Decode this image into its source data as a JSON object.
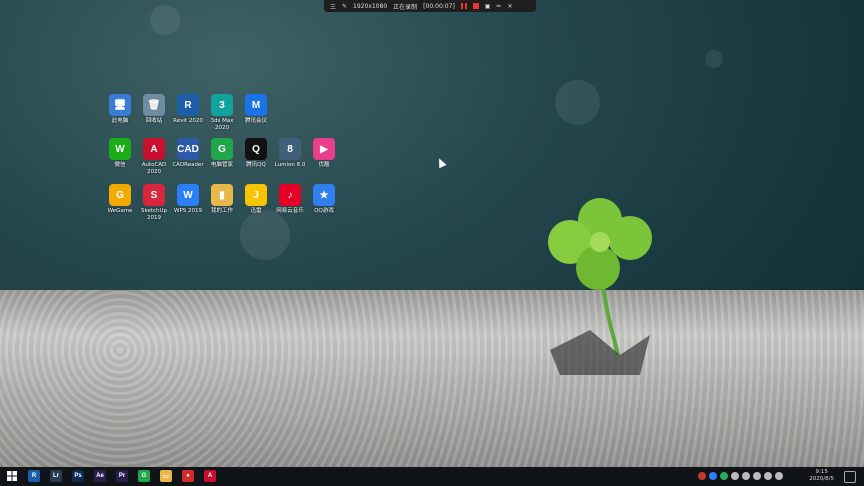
{
  "recorder_bar": {
    "menu_glyph": "三",
    "resolution": "1920x1080",
    "mode_label": "正在录制",
    "timer": "[00:00:07]"
  },
  "desktop_icons": [
    {
      "label": "此电脑",
      "color": "#3a7bd5",
      "glyph": "🖥"
    },
    {
      "label": "回收站",
      "color": "#6f8ca0",
      "glyph": "🗑"
    },
    {
      "label": "Revit 2020",
      "color": "#1c5fa8",
      "glyph": "R"
    },
    {
      "label": "3ds Max 2020",
      "color": "#10a39b",
      "glyph": "3"
    },
    {
      "label": "腾讯会议",
      "color": "#1a73e8",
      "glyph": "M"
    },
    {
      "label": "微信",
      "color": "#1aad19",
      "glyph": "W"
    },
    {
      "label": "AutoCAD 2020",
      "color": "#c8102e",
      "glyph": "A"
    },
    {
      "label": "CADReader",
      "color": "#2a5aa8",
      "glyph": "CAD"
    },
    {
      "label": "电脑管家",
      "color": "#21a64a",
      "glyph": "G"
    },
    {
      "label": "腾讯QQ",
      "color": "#111111",
      "glyph": "Q"
    },
    {
      "label": "Lumion 8.0",
      "color": "#3f5f7a",
      "glyph": "8"
    },
    {
      "label": "优酷",
      "color": "#e83e8c",
      "glyph": "▶"
    },
    {
      "label": "WeGame",
      "color": "#f2a900",
      "glyph": "G"
    },
    {
      "label": "SketchUp 2019",
      "color": "#d7263d",
      "glyph": "S"
    },
    {
      "label": "WPS 2019",
      "color": "#2d7ff9",
      "glyph": "W"
    },
    {
      "label": "我的工作",
      "color": "#e8b94a",
      "glyph": "▮"
    },
    {
      "label": "迅雷",
      "color": "#f6c400",
      "glyph": "J"
    },
    {
      "label": "网易云音乐",
      "color": "#e60026",
      "glyph": "♪"
    },
    {
      "label": "QQ游戏",
      "color": "#2f80ed",
      "glyph": "★"
    }
  ],
  "taskbar": {
    "start_icon": "windows-icon",
    "items": [
      {
        "name": "revit",
        "glyph": "R",
        "color": "#1c5fa8"
      },
      {
        "name": "lightroom",
        "glyph": "Lr",
        "color": "#2b3b52"
      },
      {
        "name": "photoshop",
        "glyph": "Ps",
        "color": "#0b2c50"
      },
      {
        "name": "after-effects",
        "glyph": "Ae",
        "color": "#2a1f4a"
      },
      {
        "name": "premiere",
        "glyph": "Pr",
        "color": "#2a1f4a"
      },
      {
        "name": "pc-manager",
        "glyph": "G",
        "color": "#21a64a"
      },
      {
        "name": "file-explorer",
        "glyph": "▭",
        "color": "#e8b94a"
      },
      {
        "name": "recorder",
        "glyph": "●",
        "color": "#d12b2b"
      },
      {
        "name": "autocad",
        "glyph": "A",
        "color": "#c8102e"
      }
    ],
    "tray_colors": [
      "#c0392b",
      "#2d7ff9",
      "#27ae60",
      "#bbbbbb",
      "#bbbbbb",
      "#bbbbbb",
      "#bbbbbb",
      "#bbbbbb"
    ],
    "time": "9:15",
    "date": "2020/8/5"
  }
}
